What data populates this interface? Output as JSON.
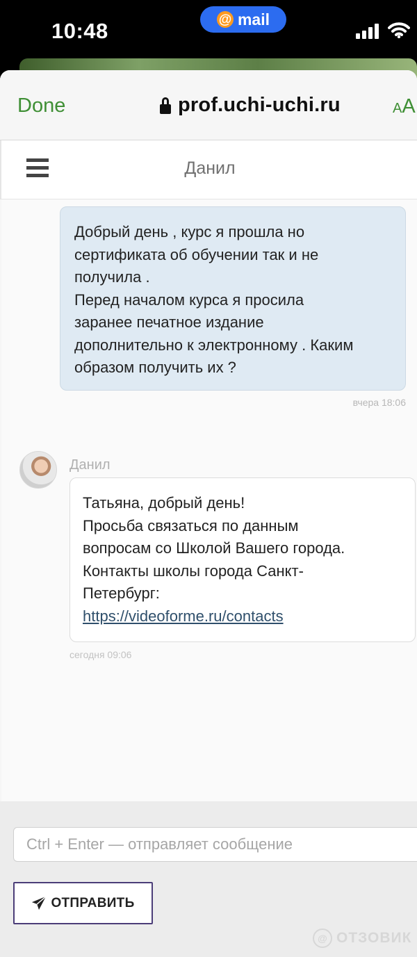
{
  "status_bar": {
    "time": "10:48",
    "mail_badge": "mail",
    "mail_symbol": "@"
  },
  "browser": {
    "done_label": "Done",
    "url": "prof.uchi-uchi.ru",
    "text_size_small": "A",
    "text_size_large": "A",
    "accent_color": "#3f8f35"
  },
  "chat": {
    "title": "Данил",
    "messages": [
      {
        "direction": "outgoing",
        "text": "Добрый день , курс я прошла но\nсертификата об обучении так и не\nполучила .\nПеред началом курса я просила\nзаранее печатное издание\nдополнительно к электронному . Каким\nобразом получить их ?",
        "time": "вчера 18:06"
      },
      {
        "direction": "incoming",
        "sender": "Данил",
        "lines": [
          "Татьяна, добрый день!",
          "Просьба связаться по данным",
          "вопросам со Школой Вашего города.",
          "Контакты школы города Санкт-",
          "Петербург:"
        ],
        "link": "https://videoforme.ru/contacts",
        "time": "сегодня 09:06"
      }
    ]
  },
  "form": {
    "input_placeholder": "Ctrl + Enter — отправляет сообщение",
    "input_value": "",
    "send_label": "ОТПРАВИТЬ",
    "button_border_color": "#4b3d78"
  },
  "watermark": {
    "symbol": "@",
    "text": "ОТЗОВИК"
  }
}
